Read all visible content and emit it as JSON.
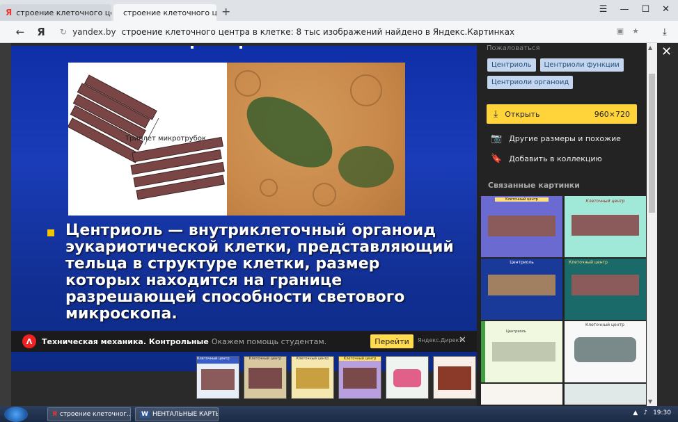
{
  "tabs": [
    {
      "title": "строение клеточного цен"
    },
    {
      "title": "строение клеточного це"
    }
  ],
  "toolbar": {
    "domain": "yandex.by",
    "address_title": "строение клеточного центра в клетке: 8 тыс изображений найдено в Яндекс.Картинках"
  },
  "slide": {
    "photo_label": "Триплет микротрубок",
    "text": "Центриоль — внутриклеточный органоид эукариотической клетки, представляющий тельца в структуре клетки, размер которых находится на границе разрешающей способности светового микроскопа."
  },
  "ad": {
    "logo": "Λ",
    "title": "Техническая механика. Контрольные",
    "text": "Окажем помощь студентам.",
    "button": "Перейти",
    "direct": "Яндекс.Директ"
  },
  "panel": {
    "report": "Пожаловаться",
    "tags": [
      "Центриоль",
      "Центриоли функции",
      "Центриоли органоид"
    ],
    "open_label": "Открыть",
    "open_size": "960×720",
    "other_sizes": "Другие размеры и похожие",
    "add_collection": "Добавить в коллекцию",
    "related_title": "Связанные картинки",
    "related": [
      {
        "title": "Клеточный центр"
      },
      {
        "title": "Клеточный центр"
      },
      {
        "title": "Центриоль"
      },
      {
        "title": "Клеточный центр"
      },
      {
        "title": "Центриоль"
      },
      {
        "title": "Клеточный центр"
      }
    ]
  },
  "thumbnails": [
    {
      "title": "Клеточный центр"
    },
    {
      "title": "Клеточный центр"
    },
    {
      "title": "Клеточный центр"
    },
    {
      "title": "Клеточный центр"
    },
    {
      "title": ""
    },
    {
      "title": ""
    }
  ],
  "taskbar": {
    "tasks": [
      "строение клеточног...",
      "НЕНТАЛЬНЫЕ КАРТЫ..."
    ],
    "time": "19:30"
  },
  "colors": {
    "slide_bg": "#1a3cb8",
    "accent_yellow": "#ffd43b",
    "tag_bg": "#c4d6ee"
  }
}
